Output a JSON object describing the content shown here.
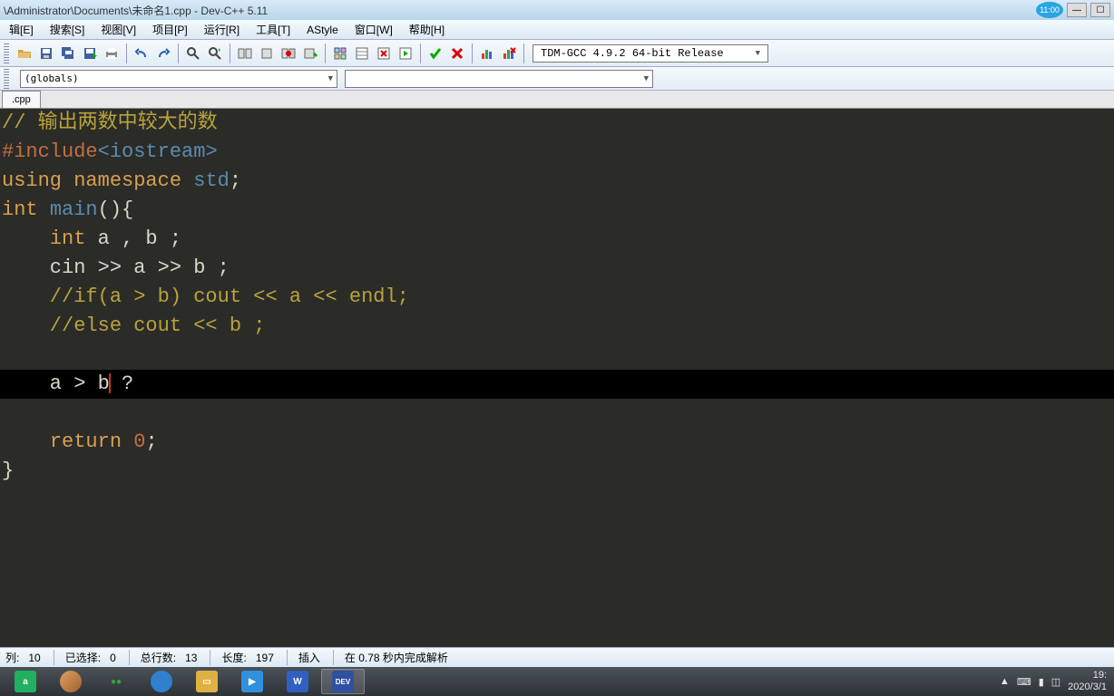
{
  "window": {
    "title": "\\Administrator\\Documents\\未命名1.cpp - Dev-C++ 5.11",
    "clock_badge": "11:00"
  },
  "menu": {
    "items": [
      "辑[E]",
      "搜索[S]",
      "视图[V]",
      "项目[P]",
      "运行[R]",
      "工具[T]",
      "AStyle",
      "窗口[W]",
      "帮助[H]"
    ]
  },
  "toolbar": {
    "compiler_selected": "TDM-GCC 4.9.2 64-bit Release"
  },
  "scope_bar": {
    "scope_selected": "(globals)",
    "member_selected": ""
  },
  "tabs": {
    "active": ".cpp"
  },
  "code": {
    "line1_comment": "// 输出两数中较大的数",
    "line2_preproc": "#include",
    "line2_include": "<iostream>",
    "line3_using": "using",
    "line3_namespace": "namespace",
    "line3_std": "std",
    "line4_int": "int",
    "line4_main": "main",
    "line5_int": "int",
    "line5_vars": " a , b ;",
    "line6": "    cin >> a >> b ;",
    "line7": "    //if(a > b) cout << a << endl;",
    "line8": "    //else cout << b ;",
    "line10_pre": "    a > b",
    "line10_post": " ?",
    "line12_return": "return",
    "line12_zero": "0",
    "line13": "}"
  },
  "status": {
    "col_label": "列:",
    "col_value": "10",
    "sel_label": "已选择:",
    "sel_value": "0",
    "lines_label": "总行数:",
    "lines_value": "13",
    "len_label": "长度:",
    "len_value": "197",
    "mode": "插入",
    "parse": "在 0.78 秒内完成解析"
  },
  "taskbar": {
    "time": "19:",
    "date": "2020/3/1"
  }
}
